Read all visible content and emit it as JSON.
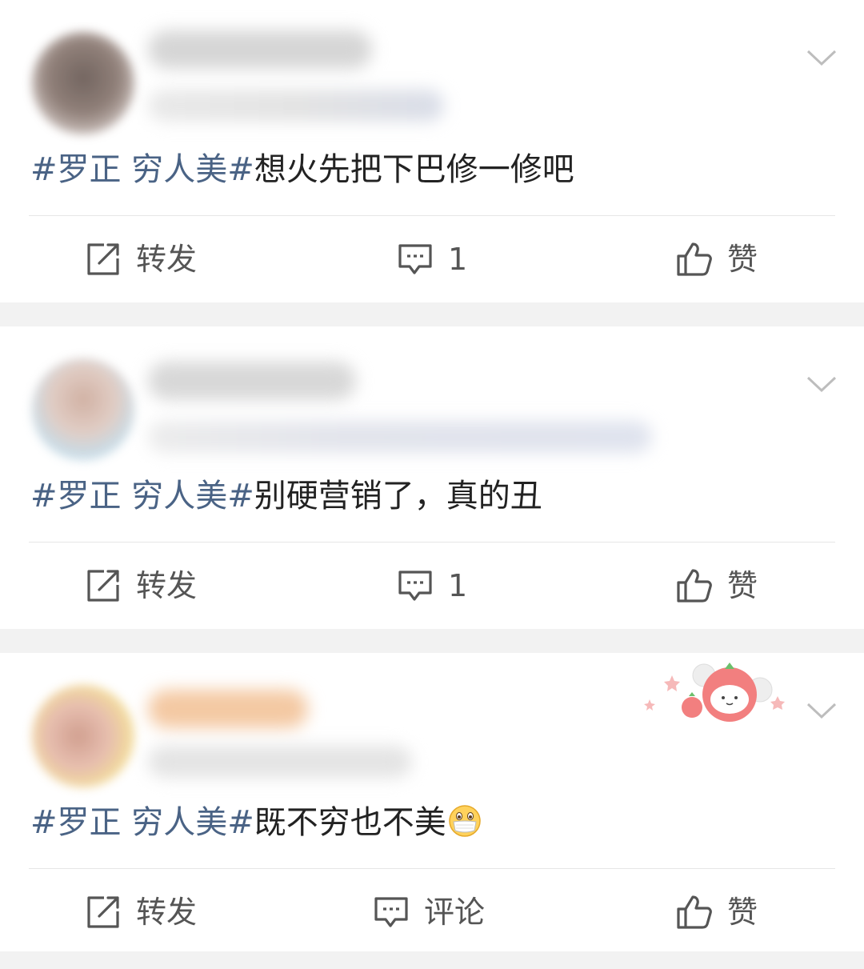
{
  "posts": [
    {
      "content": {
        "topic": "#罗正 穷人美#",
        "text": "想火先把下巴修一修吧"
      },
      "actions": {
        "repost_label": "转发",
        "comment_label": "1",
        "like_label": "赞"
      }
    },
    {
      "content": {
        "topic": "#罗正 穷人美#",
        "text": "别硬营销了，真的丑"
      },
      "actions": {
        "repost_label": "转发",
        "comment_label": "1",
        "like_label": "赞"
      }
    },
    {
      "content": {
        "topic": "#罗正 穷人美#",
        "text": "既不穷也不美",
        "emoji": "mask-face-emoji"
      },
      "actions": {
        "repost_label": "转发",
        "comment_label": "评论",
        "like_label": "赞"
      }
    }
  ],
  "icons": {
    "repost": "repost-icon",
    "comment": "comment-icon",
    "like": "thumbs-up-icon",
    "menu": "chevron-down-icon"
  },
  "colors": {
    "topic": "#4a6385",
    "text": "#222222",
    "action_text": "#555555",
    "divider": "#e6e6e6",
    "background": "#f2f2f2"
  }
}
